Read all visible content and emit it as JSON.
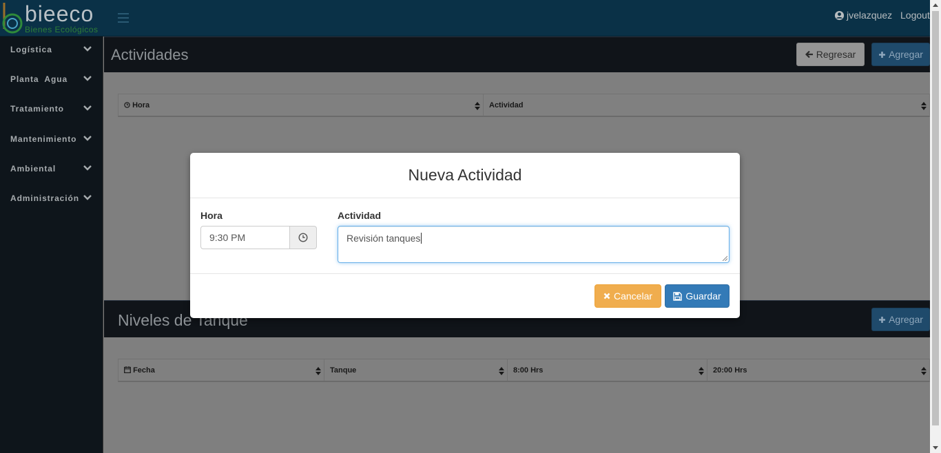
{
  "brand": {
    "name": "bieeco",
    "tagline": "Bienes Ecológicos"
  },
  "header": {
    "username": "jvelazquez",
    "logout_label": "Logout"
  },
  "sidebar": {
    "items": [
      {
        "label": "Logística"
      },
      {
        "label": "Planta  Agua"
      },
      {
        "label": "Tratamiento"
      },
      {
        "label": "Mantenimiento"
      },
      {
        "label": "Ambiental"
      },
      {
        "label": "Administración"
      }
    ]
  },
  "actividades": {
    "title": "Actividades",
    "back_label": "Regresar",
    "add_label": "Agregar",
    "columns": [
      "Hora",
      "Actividad"
    ]
  },
  "niveles": {
    "title": "Niveles de Tanque",
    "add_label": "Agregar",
    "columns": [
      "Fecha",
      "Tanque",
      "8:00 Hrs",
      "20:00 Hrs"
    ]
  },
  "modal": {
    "title": "Nueva Actividad",
    "hora_label": "Hora",
    "hora_value": "9:30 PM",
    "actividad_label": "Actividad",
    "actividad_value": "Revisión tanques",
    "cancel_label": "Cancelar",
    "save_label": "Guardar"
  },
  "colors": {
    "navbar": "#0a3147",
    "sidebar": "#0e151b",
    "primary": "#337ab7",
    "warning": "#f0ad4e"
  },
  "icons": [
    "user-circle-icon",
    "bars-icon",
    "chevron-down-icon",
    "arrow-left-icon",
    "plus-icon",
    "clock-icon",
    "calendar-icon",
    "sort-icon",
    "times-icon",
    "save-icon"
  ]
}
